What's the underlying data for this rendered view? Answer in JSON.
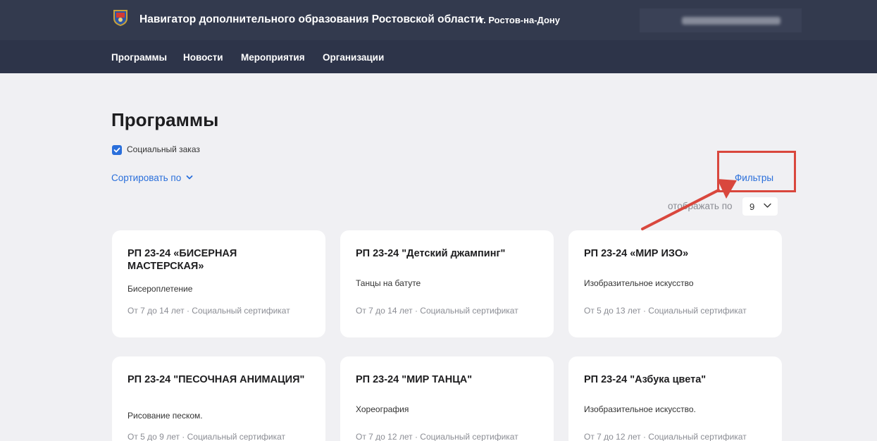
{
  "header": {
    "site_title": "Навигатор дополнительного образования Ростовской области",
    "city": "г. Ростов-на-Дону"
  },
  "nav": {
    "items": [
      {
        "label": "Программы"
      },
      {
        "label": "Новости"
      },
      {
        "label": "Мероприятия"
      },
      {
        "label": "Организации"
      }
    ]
  },
  "page": {
    "title": "Программы",
    "checkbox_label": "Социальный заказ",
    "checkbox_checked": true,
    "sort_label": "Сортировать по",
    "filters_label": "Фильтры",
    "per_page_label": "отображать по",
    "per_page_value": "9"
  },
  "colors": {
    "header_bg": "#333a4e",
    "nav_bg": "#2d3449",
    "link": "#2a6fdb",
    "annotation": "#d9473d",
    "page_bg": "#f0f0f3"
  },
  "cards": [
    {
      "title": "РП 23-24 «БИСЕРНАЯ МАСТЕРСКАЯ»",
      "subtitle": "Бисероплетение",
      "meta": "От 7 до 14 лет · Социальный сертификат"
    },
    {
      "title": "РП 23-24 \"Детский джампинг\"",
      "subtitle": "Танцы на батуте",
      "meta": "От 7 до 14 лет · Социальный сертификат"
    },
    {
      "title": "РП 23-24 «МИР ИЗО»",
      "subtitle": "Изобразительное искусство",
      "meta": "От 5 до 13 лет · Социальный сертификат"
    },
    {
      "title": "РП 23-24 \"ПЕСОЧНАЯ АНИМАЦИЯ\"",
      "subtitle": "Рисование песком.",
      "meta": "От 5 до 9 лет · Социальный сертификат"
    },
    {
      "title": "РП 23-24 \"МИР ТАНЦА\"",
      "subtitle": "Хореография",
      "meta": "От 7 до 12 лет · Социальный сертификат"
    },
    {
      "title": "РП 23-24 \"Азбука цвета\"",
      "subtitle": "Изобразительное искусство.",
      "meta": "От 7 до 12 лет · Социальный сертификат"
    }
  ]
}
